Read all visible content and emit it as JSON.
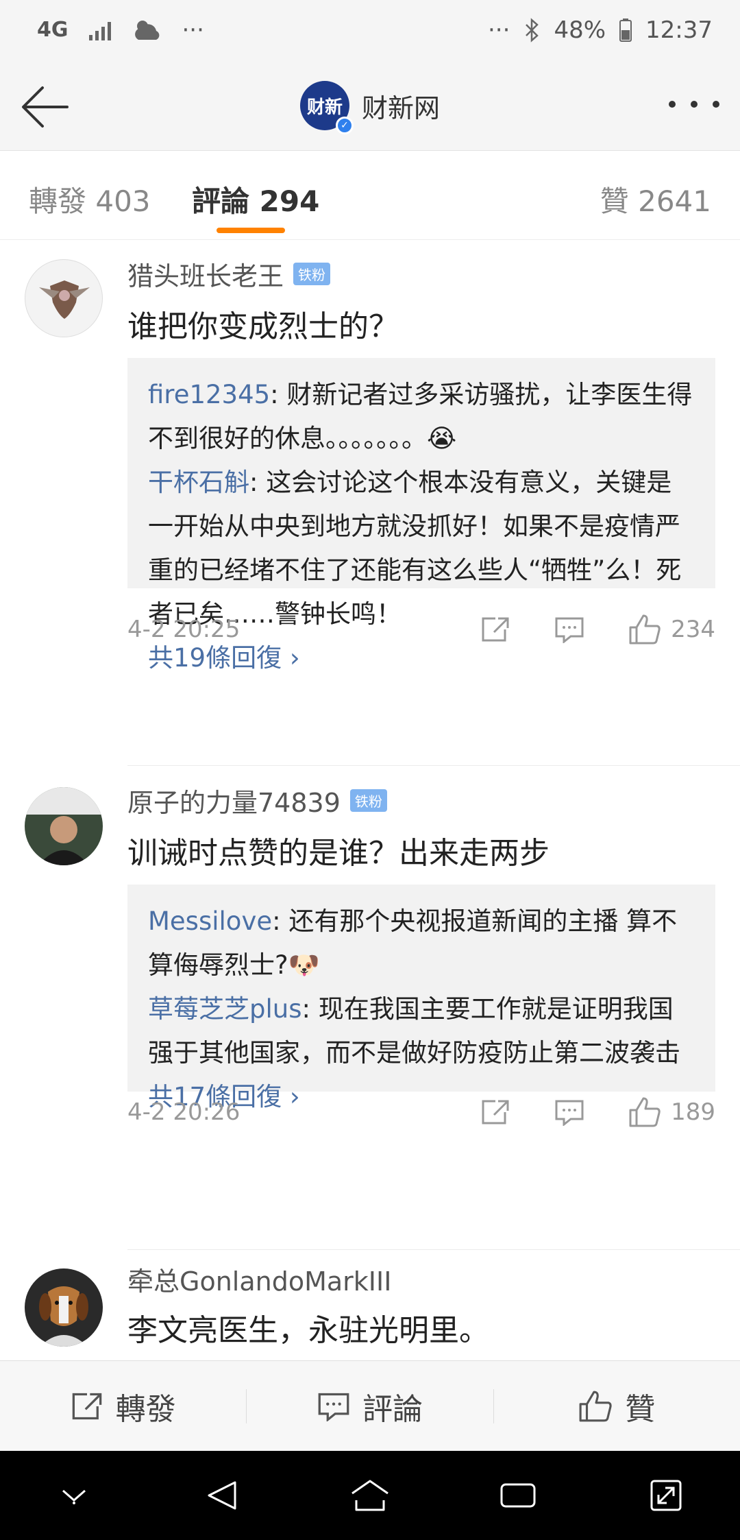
{
  "status_bar": {
    "network": "4G",
    "dots": "···",
    "battery": "48%",
    "time": "12:37",
    "icons": [
      "signal-icon",
      "weather-icon",
      "bluetooth-icon",
      "battery-icon"
    ]
  },
  "header": {
    "title": "财新网",
    "logo_text": "财新",
    "logo_color": "#1d3a8a"
  },
  "tabs": [
    {
      "label": "轉發 403",
      "active": false
    },
    {
      "label": "評論 294",
      "active": true
    },
    {
      "label": "贊 2641",
      "active": false
    }
  ],
  "accent_color": "#ff8200",
  "comments": [
    {
      "user": "猎头班长老王",
      "badge": "铁粉",
      "text": "谁把你变成烈士的？",
      "replies": [
        {
          "name": "fire12345",
          "text": ": 财新记者过多采访骚扰，让李医生得不到很好的休息。。。。。。。😭"
        },
        {
          "name": "干杯石斛",
          "text": ": 这会讨论这个根本没有意义，关键是一开始从中央到地方就没抓好！如果不是疫情严重的已经堵不住了还能有这么些人“牺牲”么！死者已矣……警钟长鸣！"
        }
      ],
      "more_replies": "共19條回復 ›",
      "time": "4-2 20:25",
      "likes": "234"
    },
    {
      "user": "原子的力量74839",
      "badge": "铁粉",
      "text": "训诫时点赞的是谁？出来走两步",
      "replies": [
        {
          "name": "Messilove",
          "text": ": 还有那个央视报道新闻的主播 算不算侮辱烈士?🐶"
        },
        {
          "name": "草莓芝芝plus",
          "text": ": 现在我国主要工作就是证明我国强于其他国家，而不是做好防疫防止第二波袭击"
        }
      ],
      "more_replies": "共17條回復 ›",
      "time": "4-2 20:26",
      "likes": "189"
    },
    {
      "user": "牵总GonlandoMarkIII",
      "text": "李文亮医生，永驻光明里。"
    }
  ],
  "action_bar": {
    "repost": "轉發",
    "comment": "評論",
    "like": "贊"
  }
}
